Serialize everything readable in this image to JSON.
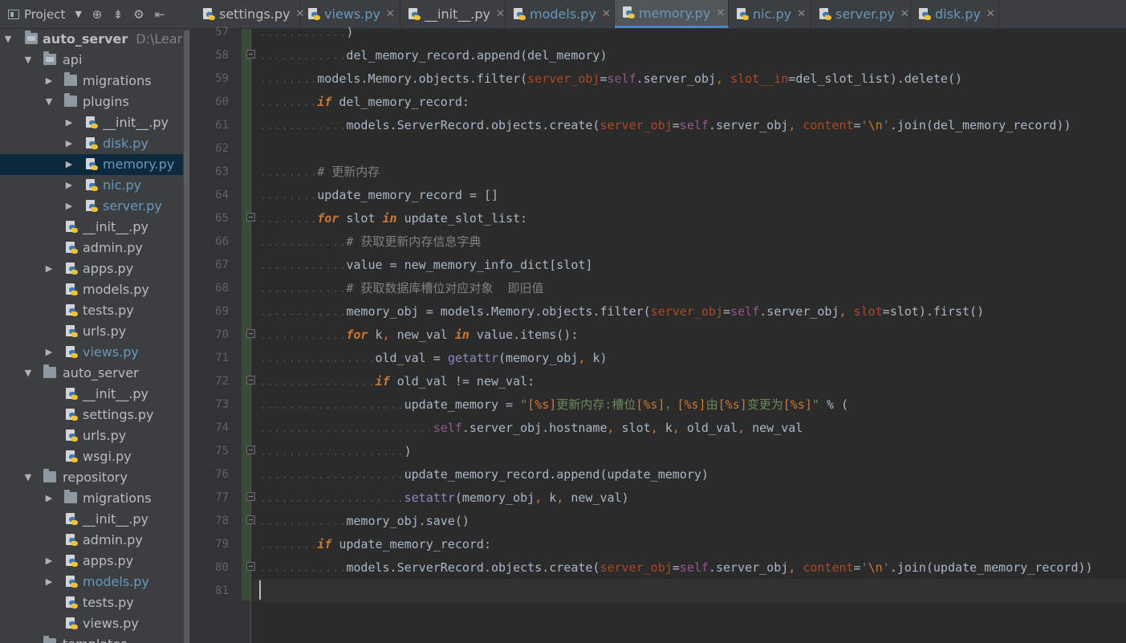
{
  "project_panel": {
    "selector_label": "Project",
    "toolbar_icons": [
      "dropdown-caret-icon",
      "target-icon",
      "collapse-icon",
      "settings-icon",
      "hide-icon"
    ],
    "root_label": "auto_server",
    "root_path": "D:\\Learn\\P",
    "items": [
      {
        "label": "api"
      },
      {
        "label": "migrations"
      },
      {
        "label": "plugins"
      },
      {
        "label": "__init__.py"
      },
      {
        "label": "disk.py"
      },
      {
        "label": "memory.py"
      },
      {
        "label": "nic.py"
      },
      {
        "label": "server.py"
      },
      {
        "label": "__init__.py"
      },
      {
        "label": "admin.py"
      },
      {
        "label": "apps.py"
      },
      {
        "label": "models.py"
      },
      {
        "label": "tests.py"
      },
      {
        "label": "urls.py"
      },
      {
        "label": "views.py"
      },
      {
        "label": "auto_server"
      },
      {
        "label": "__init__.py"
      },
      {
        "label": "settings.py"
      },
      {
        "label": "urls.py"
      },
      {
        "label": "wsgi.py"
      },
      {
        "label": "repository"
      },
      {
        "label": "migrations"
      },
      {
        "label": "__init__.py"
      },
      {
        "label": "admin.py"
      },
      {
        "label": "apps.py"
      },
      {
        "label": "models.py"
      },
      {
        "label": "tests.py"
      },
      {
        "label": "views.py"
      },
      {
        "label": "templates"
      }
    ]
  },
  "tabs": [
    {
      "label": "settings.py"
    },
    {
      "label": "views.py"
    },
    {
      "label": "__init__.py"
    },
    {
      "label": "models.py"
    },
    {
      "label": "memory.py"
    },
    {
      "label": "nic.py"
    },
    {
      "label": "server.py"
    },
    {
      "label": "disk.py"
    }
  ],
  "editor": {
    "line_numbers": [
      "57",
      "58",
      "59",
      "60",
      "61",
      "62",
      "63",
      "64",
      "65",
      "66",
      "67",
      "68",
      "69",
      "70",
      "71",
      "72",
      "73",
      "74",
      "75",
      "76",
      "77",
      "78",
      "79",
      "80",
      "81"
    ],
    "lines": [
      [
        {
          "t": ")"
        }
      ],
      [
        {
          "t": "del_memory_record.append(del_memory)"
        }
      ],
      [
        {
          "t": "models.Memory.objects.filter("
        },
        {
          "t": "server_obj",
          "c": "par"
        },
        {
          "t": "="
        },
        {
          "t": "self",
          "c": "self"
        },
        {
          "t": ".server_obj"
        },
        {
          "t": ",",
          "c": "punc"
        },
        {
          "t": " "
        },
        {
          "t": "slot__in",
          "c": "par"
        },
        {
          "t": "=del_slot_list).delete()"
        }
      ],
      [
        {
          "t": "if",
          "c": "kw"
        },
        {
          "t": " del_memory_record:"
        }
      ],
      [
        {
          "t": "models.ServerRecord.objects.create("
        },
        {
          "t": "server_obj",
          "c": "par"
        },
        {
          "t": "="
        },
        {
          "t": "self",
          "c": "self"
        },
        {
          "t": ".server_obj"
        },
        {
          "t": ",",
          "c": "punc"
        },
        {
          "t": " "
        },
        {
          "t": "content",
          "c": "par"
        },
        {
          "t": "="
        },
        {
          "t": "'",
          "c": "str"
        },
        {
          "t": "\\n",
          "c": "esc"
        },
        {
          "t": "'",
          "c": "str"
        },
        {
          "t": ".join(del_memory_record))"
        }
      ],
      [],
      [
        {
          "t": "# 更新内存",
          "c": "cmt"
        }
      ],
      [
        {
          "t": "update_memory_record = []"
        }
      ],
      [
        {
          "t": "for",
          "c": "kw"
        },
        {
          "t": " slot "
        },
        {
          "t": "in",
          "c": "kw"
        },
        {
          "t": " update_slot_list:"
        }
      ],
      [
        {
          "t": "# 获取更新内存信息字典",
          "c": "cmt"
        }
      ],
      [
        {
          "t": "value = new_memory_info_dict[slot]"
        }
      ],
      [
        {
          "t": "# 获取数据库槽位对应对象  即旧值",
          "c": "cmt"
        }
      ],
      [
        {
          "t": "memory_obj = models.Memory.objects.filter("
        },
        {
          "t": "server_obj",
          "c": "par"
        },
        {
          "t": "="
        },
        {
          "t": "self",
          "c": "self"
        },
        {
          "t": ".server_obj"
        },
        {
          "t": ",",
          "c": "punc"
        },
        {
          "t": " "
        },
        {
          "t": "slot",
          "c": "par"
        },
        {
          "t": "=slot).first()"
        }
      ],
      [
        {
          "t": "for",
          "c": "kw"
        },
        {
          "t": " k"
        },
        {
          "t": ",",
          "c": "punc"
        },
        {
          "t": " new_val "
        },
        {
          "t": "in",
          "c": "kw"
        },
        {
          "t": " value.items():"
        }
      ],
      [
        {
          "t": "old_val = "
        },
        {
          "t": "getattr",
          "c": "bi"
        },
        {
          "t": "(memory_obj"
        },
        {
          "t": ",",
          "c": "punc"
        },
        {
          "t": " k)"
        }
      ],
      [
        {
          "t": "if",
          "c": "kw"
        },
        {
          "t": " old_val != new_val:"
        }
      ],
      [
        {
          "t": "update_memory = "
        },
        {
          "t": "\"",
          "c": "str"
        },
        {
          "t": "[%s]",
          "c": "fmt"
        },
        {
          "t": "更新内存:槽位",
          "c": "str"
        },
        {
          "t": "[%s]",
          "c": "fmt"
        },
        {
          "t": "，",
          "c": "str"
        },
        {
          "t": "[%s]",
          "c": "fmt"
        },
        {
          "t": "由",
          "c": "str"
        },
        {
          "t": "[%s]",
          "c": "fmt"
        },
        {
          "t": "变更为",
          "c": "str"
        },
        {
          "t": "[%s]",
          "c": "fmt"
        },
        {
          "t": "\"",
          "c": "str"
        },
        {
          "t": " % ("
        }
      ],
      [
        {
          "t": "self",
          "c": "self"
        },
        {
          "t": ".server_obj.hostname"
        },
        {
          "t": ",",
          "c": "punc"
        },
        {
          "t": " slot"
        },
        {
          "t": ",",
          "c": "punc"
        },
        {
          "t": " k"
        },
        {
          "t": ",",
          "c": "punc"
        },
        {
          "t": " old_val"
        },
        {
          "t": ",",
          "c": "punc"
        },
        {
          "t": " new_val"
        }
      ],
      [
        {
          "t": ")"
        }
      ],
      [
        {
          "t": "update_memory_record.append(update_memory)"
        }
      ],
      [
        {
          "t": "setattr",
          "c": "bi"
        },
        {
          "t": "(memory_obj"
        },
        {
          "t": ",",
          "c": "punc"
        },
        {
          "t": " k"
        },
        {
          "t": ",",
          "c": "punc"
        },
        {
          "t": " new_val)"
        }
      ],
      [
        {
          "t": "memory_obj.save()"
        }
      ],
      [
        {
          "t": "if",
          "c": "kw"
        },
        {
          "t": " update_memory_record:"
        }
      ],
      [
        {
          "t": "models.ServerRecord.objects.create("
        },
        {
          "t": "server_obj",
          "c": "par"
        },
        {
          "t": "="
        },
        {
          "t": "self",
          "c": "self"
        },
        {
          "t": ".server_obj"
        },
        {
          "t": ",",
          "c": "punc"
        },
        {
          "t": " "
        },
        {
          "t": "content",
          "c": "par"
        },
        {
          "t": "="
        },
        {
          "t": "'",
          "c": "str"
        },
        {
          "t": "\\n",
          "c": "esc"
        },
        {
          "t": "'",
          "c": "str"
        },
        {
          "t": ".join(update_memory_record))"
        }
      ],
      []
    ]
  },
  "colors": {
    "editor_bg": "#2b2b2b",
    "keyword": "#cc7832",
    "self": "#94558d",
    "param": "#aa4926",
    "string": "#6a8759",
    "comment": "#808080",
    "builtin": "#8888c6",
    "selection": "#0d293e",
    "active_tab_accent": "#4a88c7"
  }
}
